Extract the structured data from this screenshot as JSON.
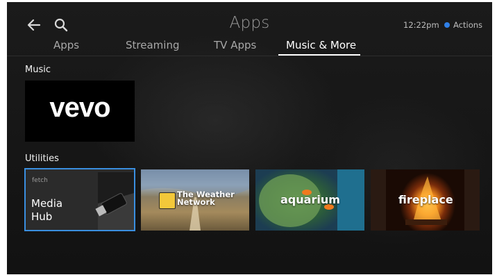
{
  "header": {
    "title": "Apps",
    "clock": "12:22pm",
    "actions_label": "Actions",
    "accent_color": "#2f7fe6"
  },
  "tabs": [
    {
      "label": "Apps",
      "active": false
    },
    {
      "label": "Streaming",
      "active": false
    },
    {
      "label": "TV Apps",
      "active": false
    },
    {
      "label": "Music & More",
      "active": true
    }
  ],
  "sections": {
    "music": {
      "title": "Music",
      "tiles": [
        {
          "label": "vevo"
        }
      ]
    },
    "utilities": {
      "title": "Utilities",
      "tiles": [
        {
          "brand": "fetch",
          "label_line1": "Media",
          "label_line2": "Hub",
          "selected": true
        },
        {
          "label_line1": "The Weather",
          "label_line2": "Network"
        },
        {
          "label": "aquarium"
        },
        {
          "label": "fireplace"
        }
      ]
    }
  },
  "icons": {
    "back": "arrow-left-icon",
    "search": "search-icon",
    "actions": "dot-icon"
  }
}
